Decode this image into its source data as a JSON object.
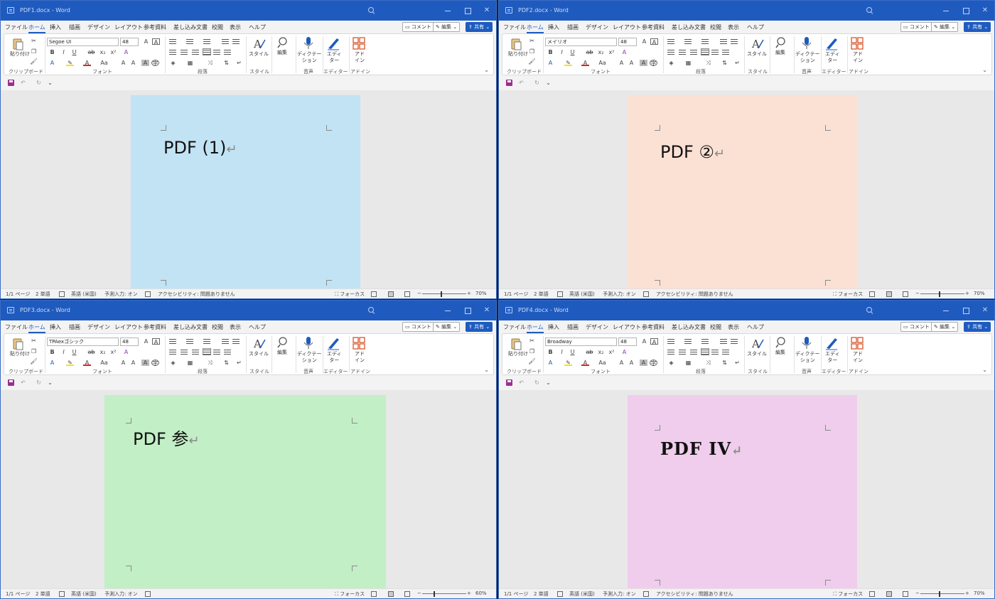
{
  "ribbon": {
    "menu": [
      "ファイル",
      "ホーム",
      "挿入",
      "描画",
      "デザイン",
      "レイアウト",
      "参考資料",
      "差し込み文書",
      "校閲",
      "表示",
      "ヘルプ"
    ],
    "comment_label": "コメント",
    "share_label": "共有",
    "groups": {
      "clipboard": "クリップボード",
      "font": "フォント",
      "paragraph": "段落",
      "style": "スタイル",
      "voice": "音声",
      "editor": "エディター",
      "addin": "アドイン"
    },
    "paste_label": "貼り付け",
    "style_label": "スタイル",
    "find_label": "編集",
    "dictation_label": "ディクテー\nション",
    "editor_label": "エディ\nター",
    "addin_label": "アド\nイン"
  },
  "windows": [
    {
      "title": "PDF1.docx - Word",
      "edit_mode": "編集",
      "font": "Segoe UI",
      "font_size": "48",
      "page_color": "#c2e3f3",
      "doc_text": "PDF (1)",
      "status": {
        "page": "1/1 ページ",
        "words": "2 単語",
        "lang": "英語 (米国)",
        "ime": "予測入力: オン",
        "accessibility": "アクセシビリティ: 問題ありません",
        "focus": "フォーカス",
        "zoom": "70%"
      }
    },
    {
      "title": "PDF2.docx - Word",
      "edit_mode": "編集",
      "font": "メイリオ",
      "font_size": "48",
      "page_color": "#fbe1d4",
      "doc_text": "PDF ②",
      "status": {
        "page": "1/1 ページ",
        "words": "2 単語",
        "lang": "英語 (米国)",
        "ime": "予測入力: オン",
        "accessibility": "アクセシビリティ: 問題ありません",
        "focus": "フォーカス",
        "zoom": "70%"
      }
    },
    {
      "title": "PDF3.docx - Word",
      "edit_mode": "編集",
      "font": "TPAexゴシック",
      "font_size": "48",
      "page_color": "#c2efc6",
      "doc_text": "PDF 参",
      "status": {
        "page": "1/1 ページ",
        "words": "2 単語",
        "lang": "英語 (米国)",
        "ime": "予測入力: オン",
        "accessibility": "",
        "focus": "フォーカス",
        "zoom": "60%"
      }
    },
    {
      "title": "PDF4.docx - Word",
      "edit_mode": "編集",
      "font": "Broadway",
      "font_size": "48",
      "page_color": "#f0cdec",
      "doc_text": "PDF IV",
      "status": {
        "page": "1/1 ページ",
        "words": "2 単語",
        "lang": "英語 (米国)",
        "ime": "予測入力: オン",
        "accessibility": "アクセシビリティ: 問題ありません",
        "focus": "フォーカス",
        "zoom": "70%"
      }
    }
  ]
}
